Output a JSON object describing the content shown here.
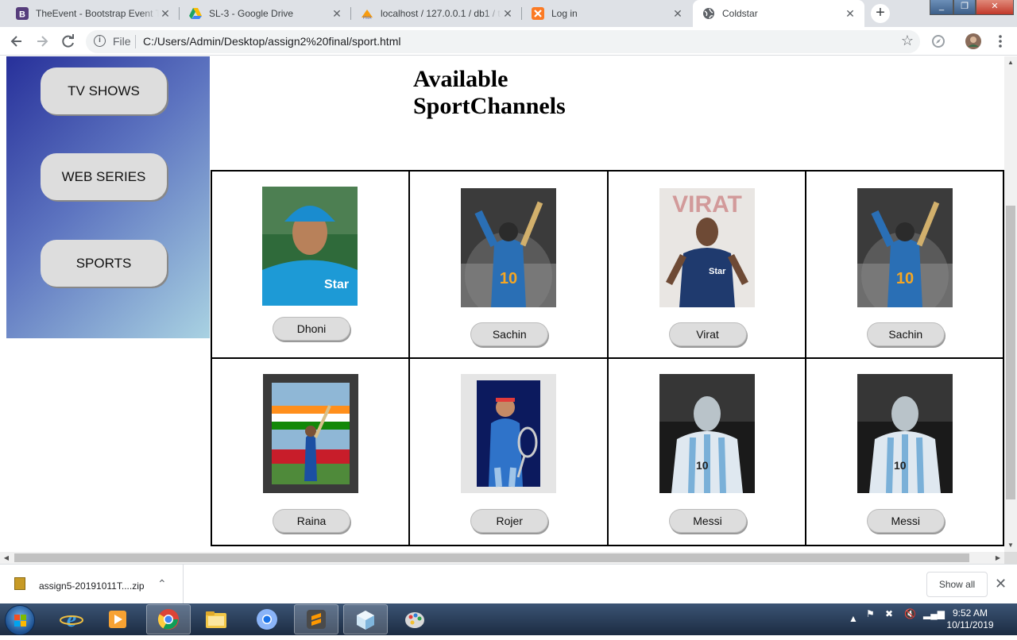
{
  "browser": {
    "tabs": [
      {
        "title": "TheEvent - Bootstrap Event T",
        "icon": "bootstrap-icon"
      },
      {
        "title": "SL-3 - Google Drive",
        "icon": "google-drive-icon"
      },
      {
        "title": "localhost / 127.0.0.1 / db1 / t",
        "icon": "phpmyadmin-icon"
      },
      {
        "title": "Log in",
        "icon": "xampp-icon"
      },
      {
        "title": "Coldstar",
        "icon": "globe-icon"
      }
    ],
    "address": {
      "scheme_label": "File",
      "url": "C:/Users/Admin/Desktop/assign2%20final/sport.html"
    }
  },
  "sidebar": {
    "items": [
      {
        "label": "TV SHOWS"
      },
      {
        "label": "WEB SERIES"
      },
      {
        "label": "SPORTS"
      }
    ]
  },
  "page": {
    "heading_line1": "Available",
    "heading_line2": "SportChannels"
  },
  "channels": [
    {
      "name": "Dhoni"
    },
    {
      "name": "Sachin"
    },
    {
      "name": "Virat"
    },
    {
      "name": "Sachin"
    },
    {
      "name": "Raina"
    },
    {
      "name": "Rojer"
    },
    {
      "name": "Messi"
    },
    {
      "name": "Messi"
    }
  ],
  "downloads": {
    "file_name": "assign5-20191011T....zip",
    "show_all_label": "Show all"
  },
  "taskbar": {
    "time": "9:52 AM",
    "date": "10/11/2019"
  },
  "colors": {
    "sidebar_gradient_start": "#27309a",
    "sidebar_gradient_end": "#a9d2e2",
    "button_bg": "#dddddd"
  }
}
